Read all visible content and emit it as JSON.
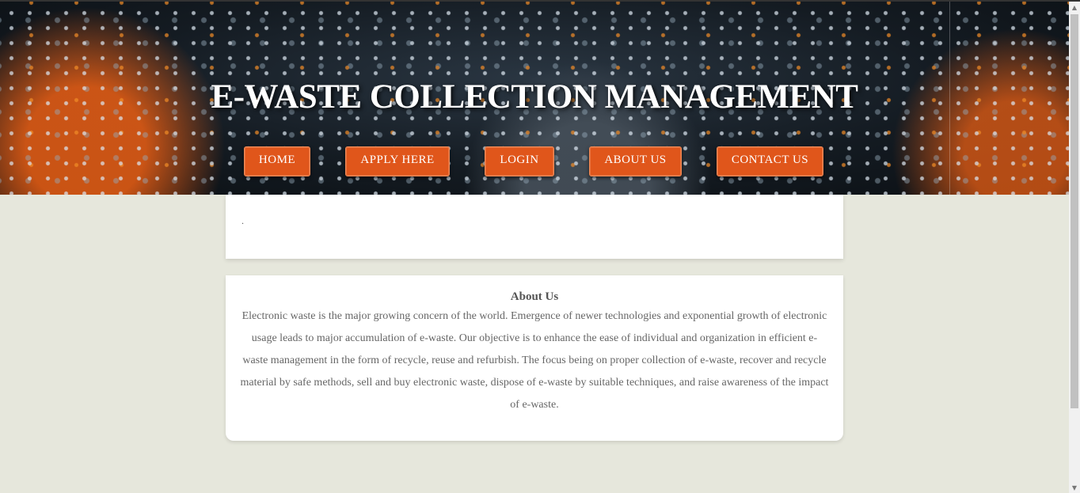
{
  "header": {
    "title": "E-WASTE COLLECTION MANAGEMENT",
    "nav": [
      {
        "label": "HOME"
      },
      {
        "label": "APPLY HERE"
      },
      {
        "label": "LOGIN"
      },
      {
        "label": "ABOUT US"
      },
      {
        "label": "CONTACT US"
      }
    ]
  },
  "notice_card": {
    "text": "."
  },
  "about": {
    "heading": "About Us",
    "body": "Electronic waste is the major growing concern of the world. Emergence of newer technologies and exponential growth of electronic usage leads to major accumulation of e-waste. Our objective is to enhance the ease of individual and organization in efficient e-waste management in the form of recycle, reuse and refurbish. The focus being on proper collection of e-waste, recover and recycle material by safe methods, sell and buy electronic waste, dispose of e-waste by suitable techniques, and raise awareness of the impact of e-waste."
  },
  "colors": {
    "accent": "#e0561b",
    "page_background": "#e6e7dc",
    "card_background": "#ffffff"
  }
}
